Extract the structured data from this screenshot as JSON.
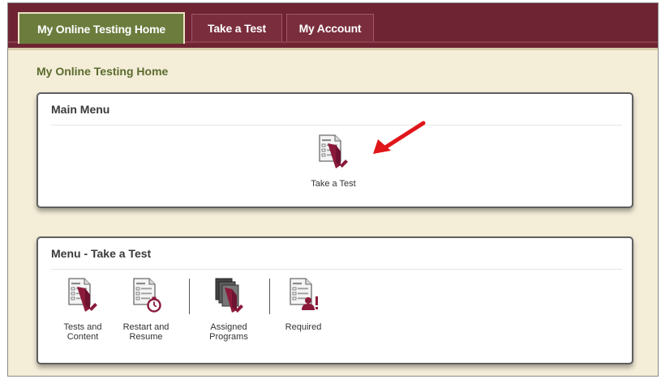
{
  "nav": {
    "tabs": [
      {
        "label": "My Online Testing Home",
        "active": true
      },
      {
        "label": "Take a Test",
        "active": false
      },
      {
        "label": "My Account",
        "active": false
      }
    ]
  },
  "page": {
    "title": "My Online Testing Home"
  },
  "main_menu": {
    "title": "Main Menu",
    "items": [
      {
        "label": "Take a Test",
        "icon": "take-test-icon"
      }
    ]
  },
  "test_menu": {
    "title": "Menu - Take a Test",
    "items": [
      {
        "label_line1": "Tests and",
        "label_line2": "Content",
        "icon": "tests-content-icon"
      },
      {
        "label_line1": "Restart and",
        "label_line2": "Resume",
        "icon": "restart-resume-icon"
      },
      {
        "label_line1": "Assigned",
        "label_line2": "Programs",
        "icon": "assigned-programs-icon"
      },
      {
        "label_line1": "Required",
        "label_line2": "",
        "icon": "required-icon"
      }
    ]
  },
  "colors": {
    "nav_bar": "#6e2433",
    "active_tab": "#6b7c3d",
    "page_background": "#f4edd8",
    "title_green": "#5a6b2e",
    "icon_maroon": "#8b1a3a",
    "arrow_red": "#e0161b"
  }
}
